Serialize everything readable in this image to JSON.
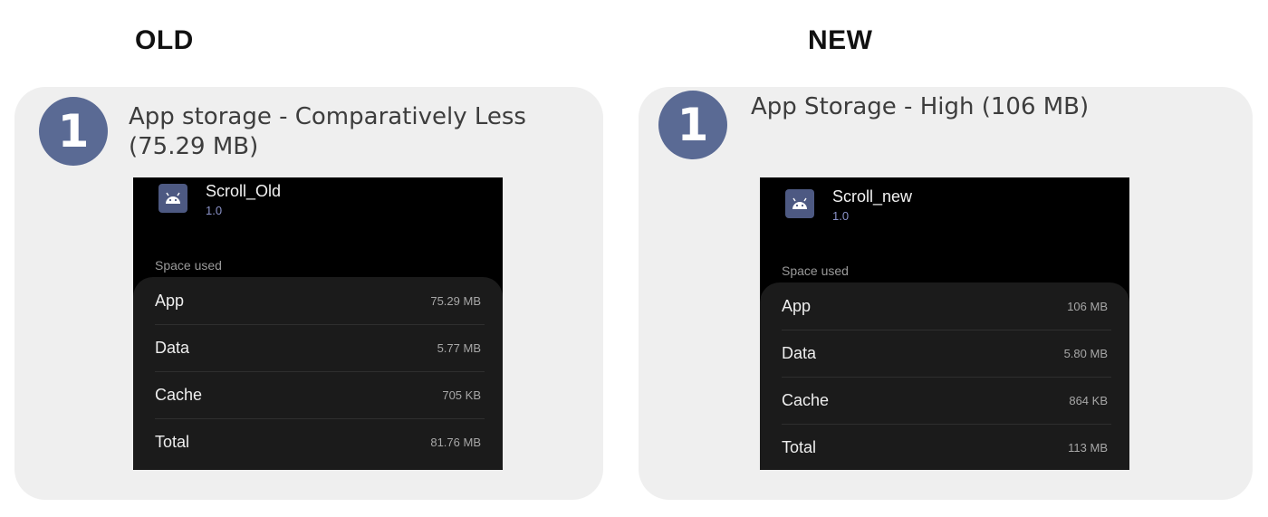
{
  "headings": {
    "old": "OLD",
    "new": "NEW"
  },
  "colors": {
    "badge": "#5a6a94",
    "panel": "#efefef",
    "phone_bg": "#000000",
    "card": "#1b1b1b",
    "version": "#8b93c9"
  },
  "old": {
    "number": "1",
    "caption": "App storage - Comparatively Less (75.29 MB)",
    "app": {
      "name": "Scroll_Old",
      "version": "1.0",
      "icon": "android-icon"
    },
    "space_label": "Space used",
    "rows": [
      {
        "label": "App",
        "value": "75.29 MB"
      },
      {
        "label": "Data",
        "value": "5.77 MB"
      },
      {
        "label": "Cache",
        "value": "705 KB"
      },
      {
        "label": "Total",
        "value": "81.76 MB"
      }
    ]
  },
  "new": {
    "number": "1",
    "caption": "App Storage - High (106 MB)",
    "app": {
      "name": "Scroll_new",
      "version": "1.0",
      "icon": "android-icon"
    },
    "space_label": "Space used",
    "rows": [
      {
        "label": "App",
        "value": "106 MB"
      },
      {
        "label": "Data",
        "value": "5.80 MB"
      },
      {
        "label": "Cache",
        "value": "864 KB"
      },
      {
        "label": "Total",
        "value": "113 MB"
      }
    ]
  }
}
